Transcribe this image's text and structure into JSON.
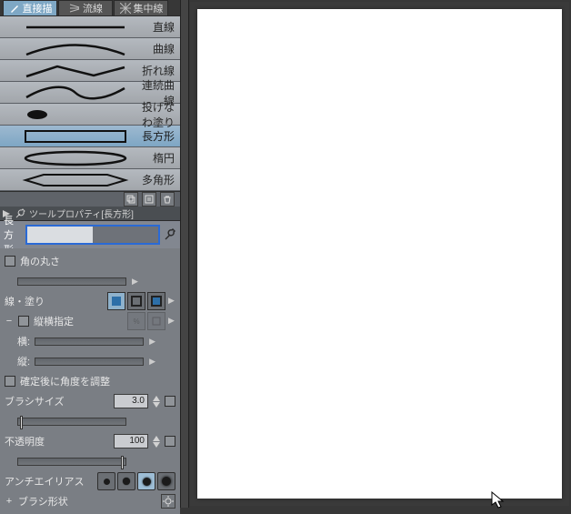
{
  "tabs": {
    "direct": "直接描",
    "stream": "流線",
    "focus": "集中線"
  },
  "shapes": {
    "line": "直線",
    "curve": "曲線",
    "polyline": "折れ線",
    "contcurve": "連続曲線",
    "lasso": "投げなわ塗り",
    "rect": "長方形",
    "ellipse": "楕円",
    "polygon": "多角形"
  },
  "prophdr": "ツールプロパティ[長方形]",
  "swatch_label": "長方形",
  "props": {
    "corner": "角の丸さ",
    "linefill": "線・塗り",
    "aspect": "縦横指定",
    "w": "横:",
    "h": "縦:",
    "afterangle": "確定後に角度を調整",
    "brush": "ブラシサイズ",
    "brush_val": "3.0",
    "opacity": "不透明度",
    "opacity_val": "100",
    "aa": "アンチエイリアス",
    "pr_shape": "ブラシ形状"
  },
  "tri": "▶"
}
